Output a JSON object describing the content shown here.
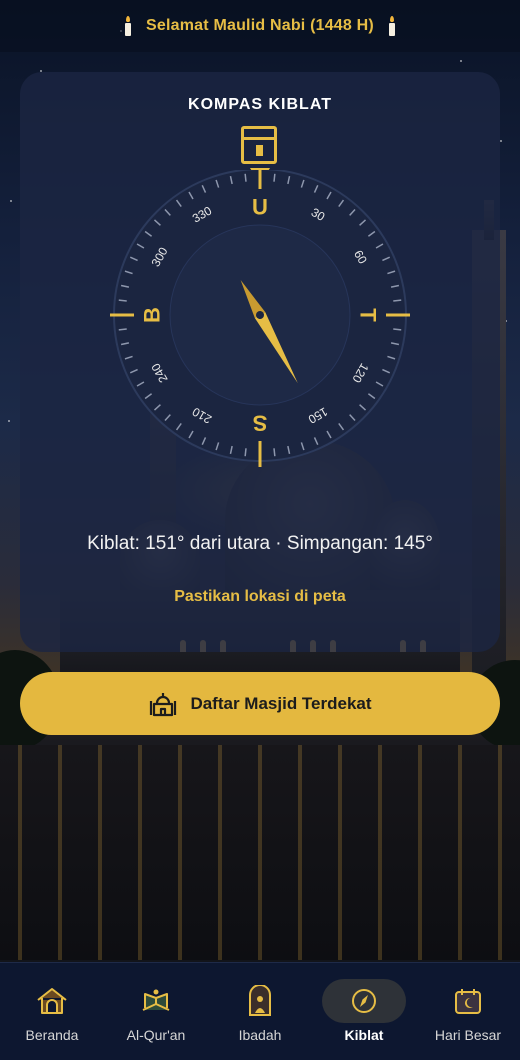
{
  "banner": {
    "text": "Selamat Maulid Nabi (1448 H)"
  },
  "compass": {
    "title": "KOMPAS KIBLAT",
    "cardinals": {
      "north": "U",
      "east": "T",
      "south": "S",
      "west": "B"
    },
    "degree_labels": [
      "30",
      "60",
      "120",
      "150",
      "210",
      "240",
      "300",
      "330"
    ],
    "needle_heading_deg": 151,
    "info": "Kiblat: 151° dari utara · Simpangan: 145°",
    "map_link": "Pastikan lokasi di peta",
    "accent_color": "#e6bd45"
  },
  "mosque_button": {
    "label": "Daftar Masjid Terdekat"
  },
  "bottom_nav": {
    "items": [
      {
        "label": "Beranda",
        "icon": "home-icon"
      },
      {
        "label": "Al-Qur'an",
        "icon": "quran-icon"
      },
      {
        "label": "Ibadah",
        "icon": "prayer-icon"
      },
      {
        "label": "Kiblat",
        "icon": "compass-icon",
        "active": true
      },
      {
        "label": "Hari Besar",
        "icon": "calendar-icon"
      }
    ]
  }
}
